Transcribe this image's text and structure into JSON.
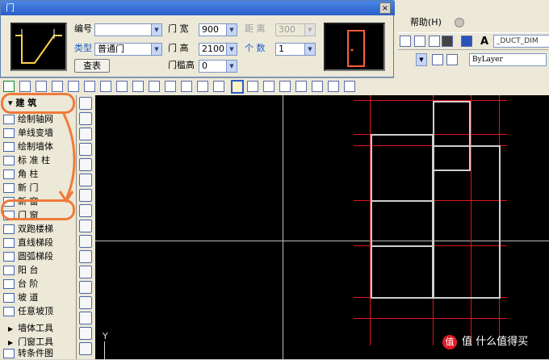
{
  "dialog": {
    "title": "门",
    "close_label": "×",
    "number_label": "编号",
    "type_label": "类型",
    "type_value": "普通门",
    "query_button": "查表",
    "door_width_label": "门 宽",
    "door_width_value": "900",
    "door_height_label": "门 高",
    "door_height_value": "2100",
    "sill_label": "门槛高",
    "sill_value": "0",
    "distance_label": "距 离",
    "distance_value": "300",
    "count_label": "个 数",
    "count_value": "1"
  },
  "menu": {
    "help": "帮助(H)"
  },
  "toolbar": {
    "style_value": "_DUCT_DIM",
    "layer_value": "ByLayer"
  },
  "sidebar": {
    "header": "建 筑",
    "items": [
      "绘制轴网",
      "单线变墙",
      "绘制墙体",
      "标 准 柱",
      "角 柱",
      "新 门",
      "新 窗",
      "门 窗",
      "双跑楼梯",
      "直线梯段",
      "圆弧梯段",
      "阳 台",
      "台 阶",
      "坡 道",
      "任意坡顶",
      "墙体工具",
      "门窗工具",
      "转条件图"
    ]
  },
  "canvas": {
    "ucs_y": "Y"
  },
  "watermark": "值 什么值得买",
  "colors": {
    "grid": "#e0161b",
    "wall": "#cfcfcf",
    "annotation": "#f07a3a",
    "title": "#2a5cc8"
  }
}
